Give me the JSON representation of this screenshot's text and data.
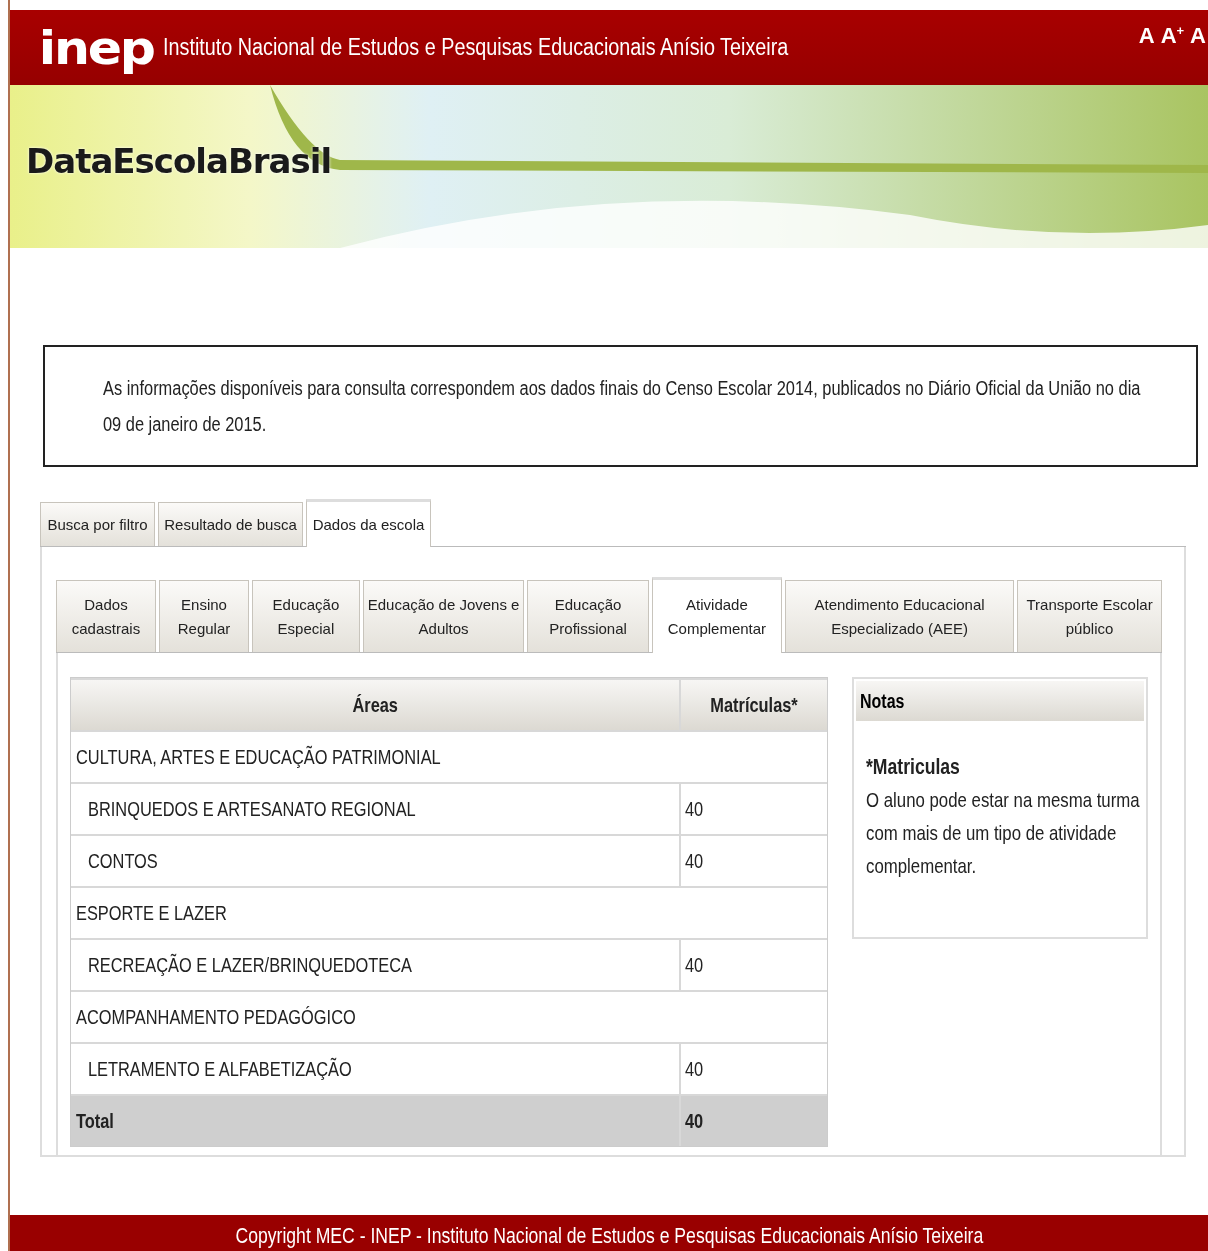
{
  "header": {
    "logo": "inep",
    "title": "Instituto Nacional de Estudos e Pesquisas Educacionais Anísio Teixeira",
    "font_controls": [
      "A",
      "A$^{+}$",
      "A"
    ]
  },
  "banner": {
    "logo": "DataEscolaBrasil"
  },
  "notice": {
    "text": "As informações disponíveis para consulta correspondem aos dados finais do Censo Escolar 2014, publicados no Diário Oficial da União no dia 09 de janeiro de 2015."
  },
  "tabs": [
    {
      "label": "Busca por filtro",
      "selected": false
    },
    {
      "label": "Resultado de busca",
      "selected": false
    },
    {
      "label": "Dados da escola",
      "selected": true
    }
  ],
  "subtabs": [
    {
      "label": "Dados cadastrais",
      "selected": false
    },
    {
      "label": "Ensino Regular",
      "selected": false
    },
    {
      "label": "Educação Especial",
      "selected": false
    },
    {
      "label": "Educação de Jovens e Adultos",
      "selected": false
    },
    {
      "label": "Educação Profissional",
      "selected": false
    },
    {
      "label": "Atividade Complementar",
      "selected": true
    },
    {
      "label": "Atendimento Educacional Especializado (AEE)",
      "selected": false
    },
    {
      "label": "Transporte Escolar público",
      "selected": false
    }
  ],
  "table": {
    "columns": [
      "Áreas",
      "Matrículas*"
    ],
    "rows": [
      {
        "kind": "group",
        "area": "CULTURA, ARTES E EDUCAÇÃO PATRIMONIAL"
      },
      {
        "kind": "item",
        "area": "BRINQUEDOS E ARTESANATO REGIONAL",
        "count": "40"
      },
      {
        "kind": "item",
        "area": "CONTOS",
        "count": "40"
      },
      {
        "kind": "group",
        "area": "ESPORTE E LAZER"
      },
      {
        "kind": "item",
        "area": "RECREAÇÃO E LAZER/BRINQUEDOTECA",
        "count": "40"
      },
      {
        "kind": "group",
        "area": "ACOMPANHAMENTO PEDAGÓGICO"
      },
      {
        "kind": "item",
        "area": "LETRAMENTO E ALFABETIZAÇÃO",
        "count": "40"
      },
      {
        "kind": "total",
        "area": "Total",
        "count": "40"
      }
    ]
  },
  "notes": {
    "title": "Notas",
    "heading": "*Matriculas",
    "text": "O aluno pode estar na mesma turma com mais de um tipo de atividade complementar."
  },
  "footer": {
    "text": "Copyright MEC - INEP - Instituto Nacional de Estudos e Pesquisas Educacionais Anísio Teixeira"
  }
}
